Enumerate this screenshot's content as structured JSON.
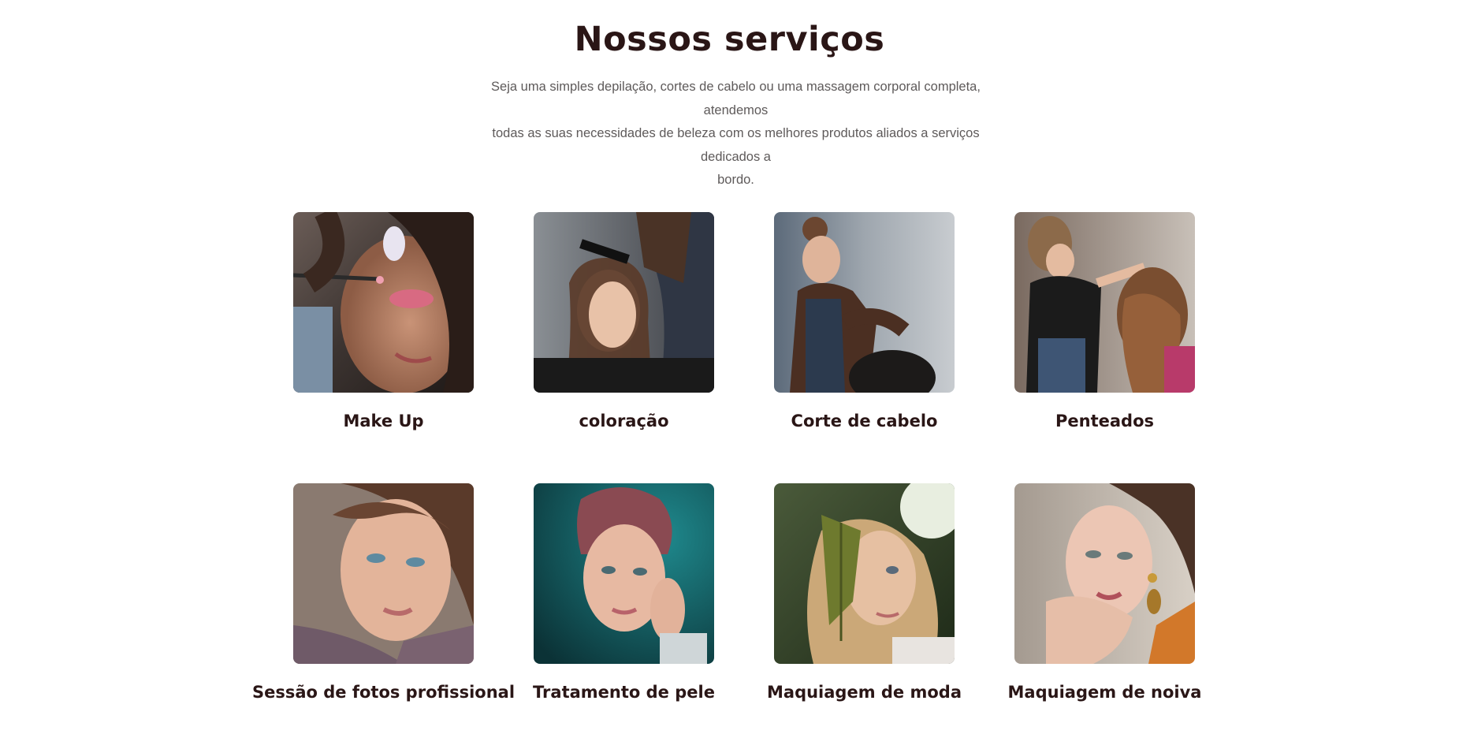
{
  "section": {
    "title": "Nossos serviços",
    "subtitle_lines": [
      "Seja uma simples depilação, cortes de cabelo ou uma massagem corporal completa, atendemos",
      "todas as suas necessidades de beleza com os melhores produtos aliados a serviços dedicados a",
      "bordo."
    ]
  },
  "colors": {
    "heading": "#2a1616",
    "body_text": "#5e5a5a",
    "background": "#ffffff"
  },
  "services": [
    {
      "label": "Make Up",
      "image": "makeup-artist-applying-pink-eyeshadow-photo"
    },
    {
      "label": "coloração",
      "image": "hair-coloring-salon-photo"
    },
    {
      "label": "Corte de cabelo",
      "image": "hairdresser-cutting-hair-photo"
    },
    {
      "label": "Penteados",
      "image": "stylist-curling-hair-photo"
    },
    {
      "label": "Sessão de fotos profissional",
      "image": "portrait-woman-turtleneck-photo"
    },
    {
      "label": "Tratamento de pele",
      "image": "portrait-woman-teal-background-photo"
    },
    {
      "label": "Maquiagem de moda",
      "image": "woman-holding-fern-leaf-photo"
    },
    {
      "label": "Maquiagem de noiva",
      "image": "bridal-makeup-portrait-photo"
    }
  ]
}
